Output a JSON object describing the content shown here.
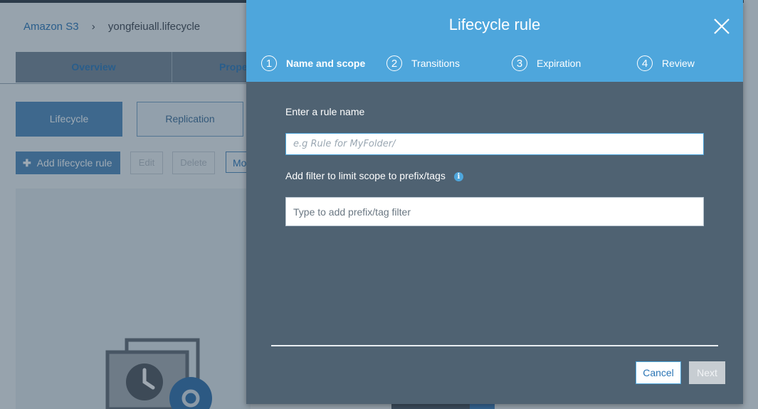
{
  "background": {
    "breadcrumb": {
      "root": "Amazon S3",
      "separator": "›",
      "bucket": "yongfeiuall.lifecycle"
    },
    "tabs": [
      {
        "label": "Overview"
      },
      {
        "label": "Prope"
      }
    ],
    "subtabs": [
      {
        "label": "Lifecycle"
      },
      {
        "label": "Replication"
      }
    ],
    "actions": {
      "add_label": "Add lifecycle rule",
      "edit_label": "Edit",
      "delete_label": "Delete",
      "more_label": "Mo"
    }
  },
  "modal": {
    "title": "Lifecycle rule",
    "steps": [
      {
        "number": "1",
        "label": "Name and scope",
        "active": true
      },
      {
        "number": "2",
        "label": "Transitions",
        "active": false
      },
      {
        "number": "3",
        "label": "Expiration",
        "active": false
      },
      {
        "number": "4",
        "label": "Review",
        "active": false
      }
    ],
    "rule_name": {
      "label": "Enter a rule name",
      "placeholder": "e.g Rule for MyFolder/",
      "value": ""
    },
    "filter": {
      "label": "Add filter to limit scope to prefix/tags",
      "info_icon": "info-icon",
      "placeholder": "Type to add prefix/tag filter",
      "value": ""
    },
    "buttons": {
      "cancel": "Cancel",
      "next": "Next"
    }
  },
  "colors": {
    "header": "#4ea6dc",
    "modal_body": "#4f6272",
    "accent": "#2b75b5",
    "disabled": "#c7cdd2"
  }
}
